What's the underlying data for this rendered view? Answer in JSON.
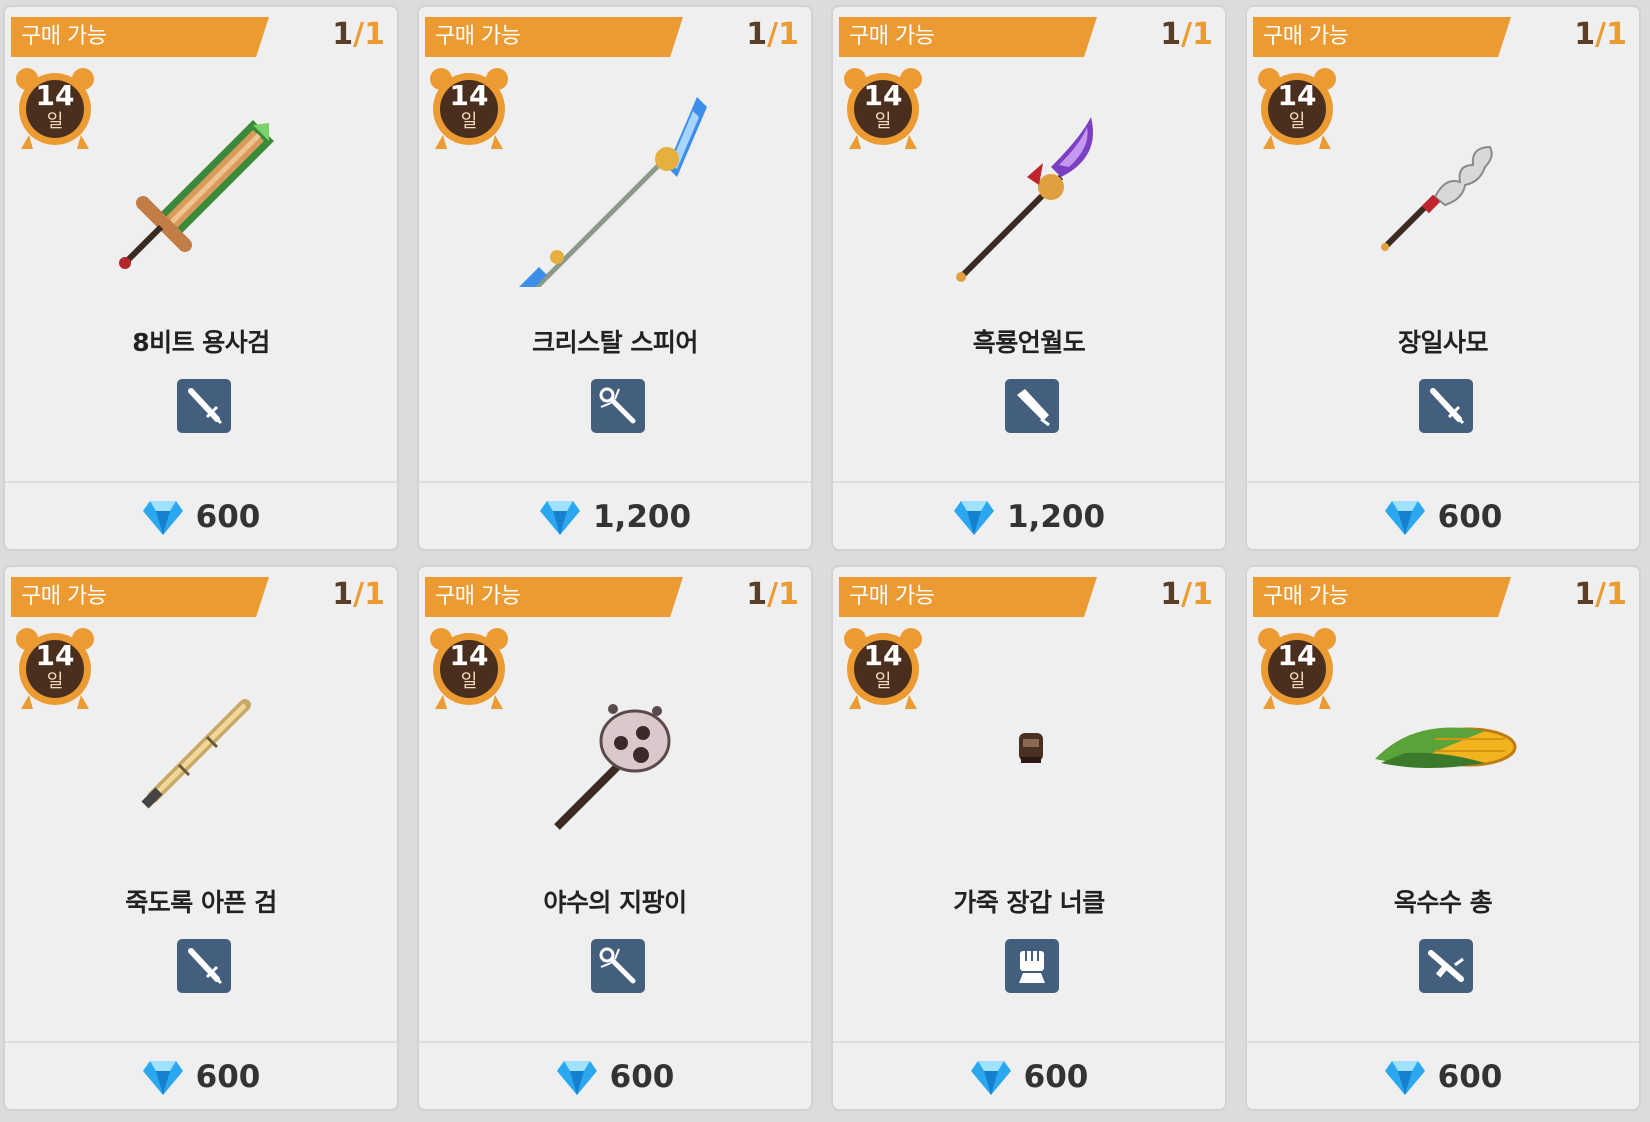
{
  "items": [
    {
      "status": "구매 가능",
      "count_current": "1",
      "count_sep": "/",
      "count_total": "1",
      "days": "14",
      "days_unit": "일",
      "name": "8비트 용사검",
      "type_icon": "sword-type-icon",
      "price": "600",
      "art": "green-sword-icon"
    },
    {
      "status": "구매 가능",
      "count_current": "1",
      "count_sep": "/",
      "count_total": "1",
      "days": "14",
      "days_unit": "일",
      "name": "크리스탈 스피어",
      "type_icon": "staff-type-icon",
      "price": "1,200",
      "art": "crystal-spear-icon"
    },
    {
      "status": "구매 가능",
      "count_current": "1",
      "count_sep": "/",
      "count_total": "1",
      "days": "14",
      "days_unit": "일",
      "name": "흑룡언월도",
      "type_icon": "blade-type-icon",
      "price": "1,200",
      "art": "glaive-icon"
    },
    {
      "status": "구매 가능",
      "count_current": "1",
      "count_sep": "/",
      "count_total": "1",
      "days": "14",
      "days_unit": "일",
      "name": "장일사모",
      "type_icon": "sword-type-icon",
      "price": "600",
      "art": "serpent-spear-icon"
    },
    {
      "status": "구매 가능",
      "count_current": "1",
      "count_sep": "/",
      "count_total": "1",
      "days": "14",
      "days_unit": "일",
      "name": "죽도록 아픈 검",
      "type_icon": "sword-type-icon",
      "price": "600",
      "art": "bamboo-sword-icon"
    },
    {
      "status": "구매 가능",
      "count_current": "1",
      "count_sep": "/",
      "count_total": "1",
      "days": "14",
      "days_unit": "일",
      "name": "야수의 지팡이",
      "type_icon": "staff-type-icon",
      "price": "600",
      "art": "paw-staff-icon"
    },
    {
      "status": "구매 가능",
      "count_current": "1",
      "count_sep": "/",
      "count_total": "1",
      "days": "14",
      "days_unit": "일",
      "name": "가죽 장갑 너클",
      "type_icon": "fist-type-icon",
      "price": "600",
      "art": "leather-knuckle-icon"
    },
    {
      "status": "구매 가능",
      "count_current": "1",
      "count_sep": "/",
      "count_total": "1",
      "days": "14",
      "days_unit": "일",
      "name": "옥수수 총",
      "type_icon": "gun-type-icon",
      "price": "600",
      "art": "corn-gun-icon"
    }
  ],
  "colors": {
    "banner": "#ec9b33",
    "badge": "#445f7d",
    "count_current": "#5a3d26",
    "gem": "#2aa7ee"
  },
  "price_icon": "gem-icon",
  "days_icon": "alarm-clock-icon"
}
